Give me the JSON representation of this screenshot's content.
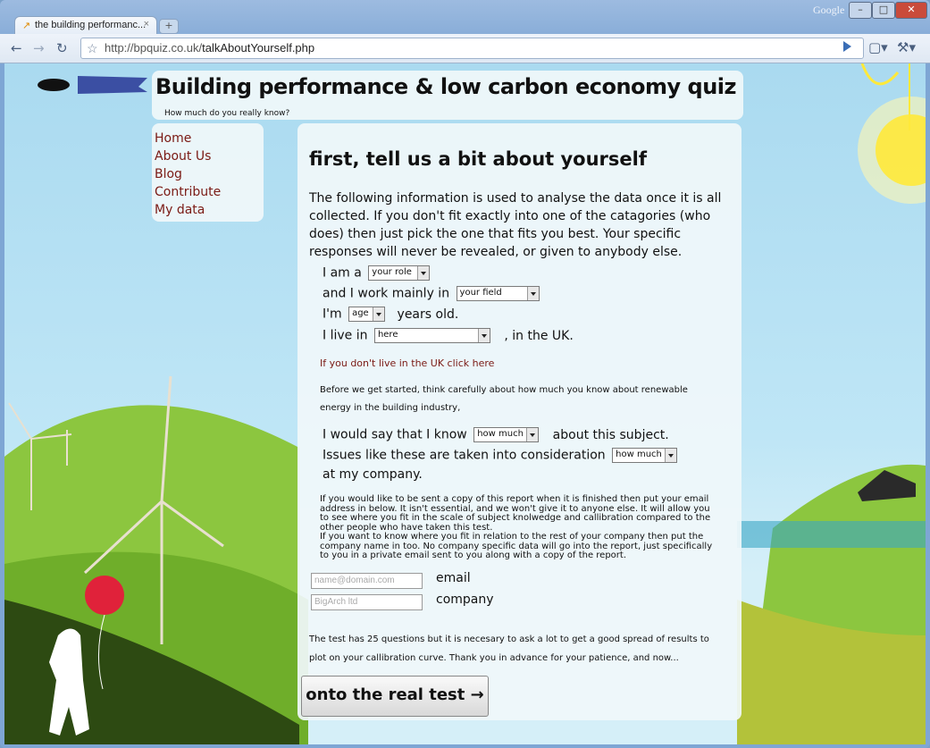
{
  "browser": {
    "tab_title": "the building performanc...",
    "tab_close": "×",
    "new_tab": "+",
    "google_text": "Google",
    "url_domain": "http://bpquiz.co.uk/",
    "url_path": "talkAboutYourself.php"
  },
  "site": {
    "title": "Building performance & low carbon economy quiz",
    "subtitle": "How much do you really know?"
  },
  "nav": {
    "items": [
      "Home",
      "About Us",
      "Blog",
      "Contribute",
      "My data"
    ]
  },
  "form": {
    "heading": "first, tell us a bit about yourself",
    "intro": "The following information is used to analyse the data once it is all collected. If you don't fit exactly into one of the catagories (who does) then just pick the one that fits you best. Your specific responses will never be revealed, or given to anybody else.",
    "role_pre": "I am a",
    "role_select": "your role",
    "field_pre": "and I work mainly in",
    "field_select": "your field",
    "age_pre": "I'm",
    "age_select": "age",
    "age_post": "years old.",
    "live_pre": "I live in",
    "live_select": "here",
    "live_post": ", in the UK.",
    "uk_link": "If you don't live in the UK click here",
    "think_text": "Before we get started, think carefully about how much you know about renewable energy in the building industry,",
    "know_pre": "I would say that I know",
    "know_select": "how much",
    "know_post": "about this subject.",
    "issues_pre": "Issues like these are taken into consideration",
    "issues_select": "how much",
    "issues_post": "at my company.",
    "email_text_1": "If you would like to be sent a copy of this report when it is finished then put your email address in below. It isn't essential, and we won't give it to anyone else. It will allow you to see where you fit in the scale of subject knolwedge and callibration compared to the other people who have taken this test.",
    "email_text_2": "If you want to know where you fit in relation to the rest of your company then put the company name in too. No company specific data will go into the report, just specifically to you in a private email sent to you along with a copy of the report.",
    "email_placeholder": "name@domain.com",
    "email_label": "email",
    "company_placeholder": "BigArch ltd",
    "company_label": "company",
    "bottom_text": "The test has 25 questions but it is necesary to ask a lot to get a good spread of results to plot on your callibration curve. Thank you in advance for your patience, and now...",
    "submit_label": "onto the real test →"
  }
}
